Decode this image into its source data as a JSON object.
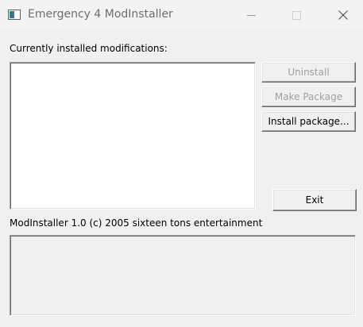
{
  "window": {
    "title": "Emergency 4 ModInstaller"
  },
  "caption_buttons": {
    "minimize": "minimize-icon",
    "maximize": "maximize-icon",
    "close": "close-icon"
  },
  "main": {
    "installed_label": "Currently installed modifications:",
    "installed_mods": [],
    "version_label": "ModInstaller 1.0 (c) 2005 sixteen tons entertainment",
    "info_text": ""
  },
  "buttons": {
    "uninstall": "Uninstall",
    "make_package": "Make Package",
    "install_package": "Install package...",
    "exit": "Exit"
  },
  "colors": {
    "window_bg": "#f0f0f0",
    "disabled_text": "#a0a0a0",
    "list_bg": "#ffffff"
  }
}
